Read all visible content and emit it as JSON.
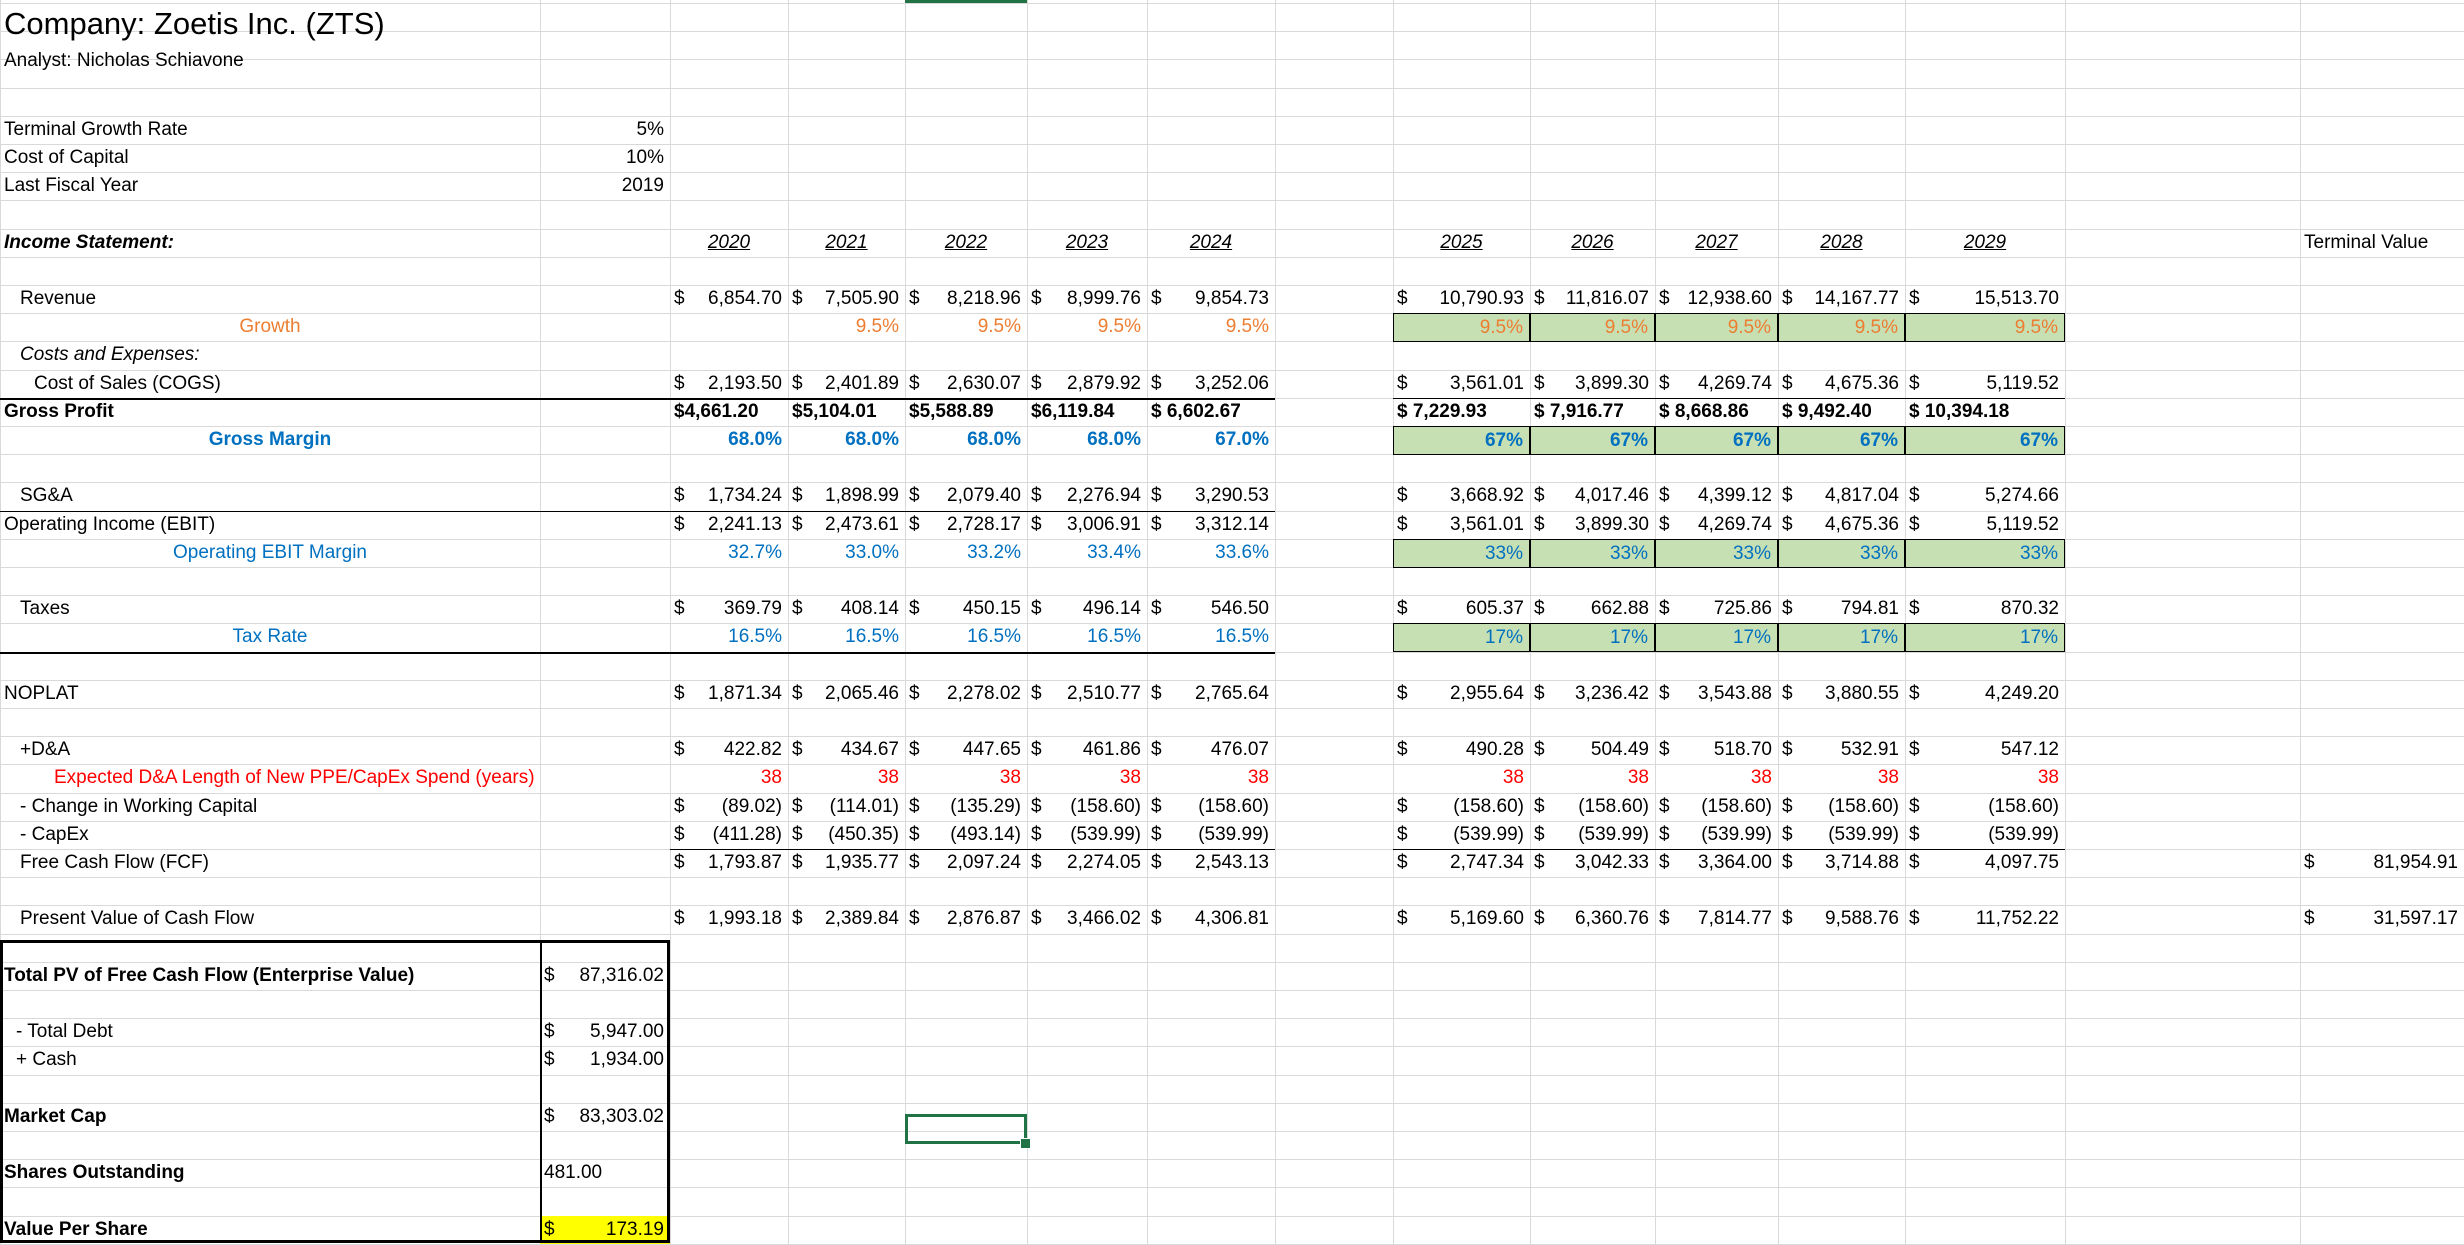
{
  "header": {
    "title": "Company: Zoetis Inc. (ZTS)",
    "analyst": "Analyst: Nicholas Schiavone"
  },
  "assumptions": [
    {
      "label": "Terminal Growth Rate",
      "value": "5%"
    },
    {
      "label": "Cost of Capital",
      "value": "10%"
    },
    {
      "label": "Last Fiscal Year",
      "value": "2019"
    }
  ],
  "income_statement_label": "Income Statement:",
  "terminal_value_label": "Terminal Value",
  "years": [
    "2020",
    "2021",
    "2022",
    "2023",
    "2024",
    "2025",
    "2026",
    "2027",
    "2028",
    "2029"
  ],
  "rows": {
    "revenue": {
      "label": "Revenue",
      "values": [
        "$6,854.70",
        "$7,505.90",
        "$8,218.96",
        "$8,999.76",
        "$ 9,854.73",
        "$ 10,790.93",
        "$ 11,816.07",
        "$ 12,938.60",
        "$ 14,167.77",
        "$ 15,513.70"
      ]
    },
    "growth": {
      "label": "Growth",
      "values": [
        "",
        "9.5%",
        "9.5%",
        "9.5%",
        "9.5%",
        "9.5%",
        "9.5%",
        "9.5%",
        "9.5%",
        "9.5%"
      ]
    },
    "costs_label": "Costs and Expenses:",
    "cogs": {
      "label": "Cost of Sales (COGS)",
      "values": [
        "$2,193.50",
        "$2,401.89",
        "$2,630.07",
        "$2,879.92",
        "$ 3,252.06",
        "$ 3,561.01",
        "$ 3,899.30",
        "$ 4,269.74",
        "$ 4,675.36",
        "$ 5,119.52"
      ]
    },
    "gross_profit": {
      "label": "Gross Profit",
      "values": [
        "$4,661.20",
        "$5,104.01",
        "$5,588.89",
        "$6,119.84",
        "$ 6,602.67",
        "$ 7,229.93",
        "$ 7,916.77",
        "$ 8,668.86",
        "$ 9,492.40",
        "$ 10,394.18"
      ]
    },
    "gross_margin": {
      "label": "Gross Margin",
      "values": [
        "68.0%",
        "68.0%",
        "68.0%",
        "68.0%",
        "67.0%",
        "67%",
        "67%",
        "67%",
        "67%",
        "67%"
      ]
    },
    "sga": {
      "label": "SG&A",
      "values": [
        "$1,734.24",
        "$1,898.99",
        "$2,079.40",
        "$2,276.94",
        "$ 3,290.53",
        "$ 3,668.92",
        "$ 4,017.46",
        "$ 4,399.12",
        "$ 4,817.04",
        "$ 5,274.66"
      ]
    },
    "ebit": {
      "label": "Operating Income (EBIT)",
      "values": [
        "$2,241.13",
        "$2,473.61",
        "$2,728.17",
        "$3,006.91",
        "$ 3,312.14",
        "$ 3,561.01",
        "$ 3,899.30",
        "$ 4,269.74",
        "$ 4,675.36",
        "$ 5,119.52"
      ]
    },
    "ebit_margin": {
      "label": "Operating EBIT Margin",
      "values": [
        "32.7%",
        "33.0%",
        "33.2%",
        "33.4%",
        "33.6%",
        "33%",
        "33%",
        "33%",
        "33%",
        "33%"
      ]
    },
    "taxes": {
      "label": "Taxes",
      "values": [
        "$ 369.79",
        "$ 408.14",
        "$ 450.15",
        "$ 496.14",
        "$ 546.50",
        "$ 605.37",
        "$ 662.88",
        "$ 725.86",
        "$ 794.81",
        "$ 870.32"
      ]
    },
    "tax_rate": {
      "label": "Tax Rate",
      "values": [
        "16.5%",
        "16.5%",
        "16.5%",
        "16.5%",
        "16.5%",
        "17%",
        "17%",
        "17%",
        "17%",
        "17%"
      ]
    },
    "noplat": {
      "label": "NOPLAT",
      "values": [
        "$1,871.34",
        "$2,065.46",
        "$2,278.02",
        "$2,510.77",
        "$ 2,765.64",
        "$ 2,955.64",
        "$ 3,236.42",
        "$ 3,543.88",
        "$ 3,880.55",
        "$ 4,249.20"
      ]
    },
    "da": {
      "label": "+D&A",
      "values": [
        "$ 422.82",
        "$ 434.67",
        "$ 447.65",
        "$ 461.86",
        "$ 476.07",
        "$ 490.28",
        "$ 504.49",
        "$ 518.70",
        "$ 532.91",
        "$ 547.12"
      ]
    },
    "da_length": {
      "label": "Expected D&A Length of New PPE/CapEx Spend (years)",
      "values": [
        "38",
        "38",
        "38",
        "38",
        "38",
        "38",
        "38",
        "38",
        "38",
        "38"
      ]
    },
    "wc": {
      "label": "- Change in Working Capital",
      "values": [
        "$ (89.02)",
        "$ (114.01)",
        "$ (135.29)",
        "$ (158.60)",
        "$ (158.60)",
        "$ (158.60)",
        "$ (158.60)",
        "$ (158.60)",
        "$ (158.60)",
        "$ (158.60)"
      ]
    },
    "capex": {
      "label": "- CapEx",
      "values": [
        "$ (411.28)",
        "$ (450.35)",
        "$ (493.14)",
        "$ (539.99)",
        "$ (539.99)",
        "$ (539.99)",
        "$ (539.99)",
        "$ (539.99)",
        "$ (539.99)",
        "$ (539.99)"
      ]
    },
    "fcf": {
      "label": "Free Cash Flow (FCF)",
      "values": [
        "$1,793.87",
        "$1,935.77",
        "$2,097.24",
        "$2,274.05",
        "$ 2,543.13",
        "$ 2,747.34",
        "$ 3,042.33",
        "$ 3,364.00",
        "$ 3,714.88",
        "$ 4,097.75"
      ],
      "terminal": "$ 81,954.91"
    },
    "pv": {
      "label": "Present Value of Cash Flow",
      "values": [
        "$1,993.18",
        "$2,389.84",
        "$2,876.87",
        "$3,466.02",
        "$ 4,306.81",
        "$ 5,169.60",
        "$ 6,360.76",
        "$ 7,814.77",
        "$ 9,588.76",
        "$ 11,752.22"
      ],
      "terminal": "$ 31,597.17"
    }
  },
  "summary": [
    {
      "label": "Total PV of Free Cash Flow (Enterprise Value)",
      "value": "$87,316.02",
      "bold": true
    },
    {
      "label": "- Total Debt",
      "value": "$ 5,947.00"
    },
    {
      "label": "+ Cash",
      "value": "$ 1,934.00"
    },
    {
      "label": "Market Cap",
      "value": "$83,303.02",
      "bold": true
    },
    {
      "label": "Shares Outstanding",
      "value": "481.00",
      "bold": true
    },
    {
      "label": "Value Per Share",
      "value": "$ 173.19",
      "bold": true,
      "highlight": "#ffff00"
    }
  ]
}
